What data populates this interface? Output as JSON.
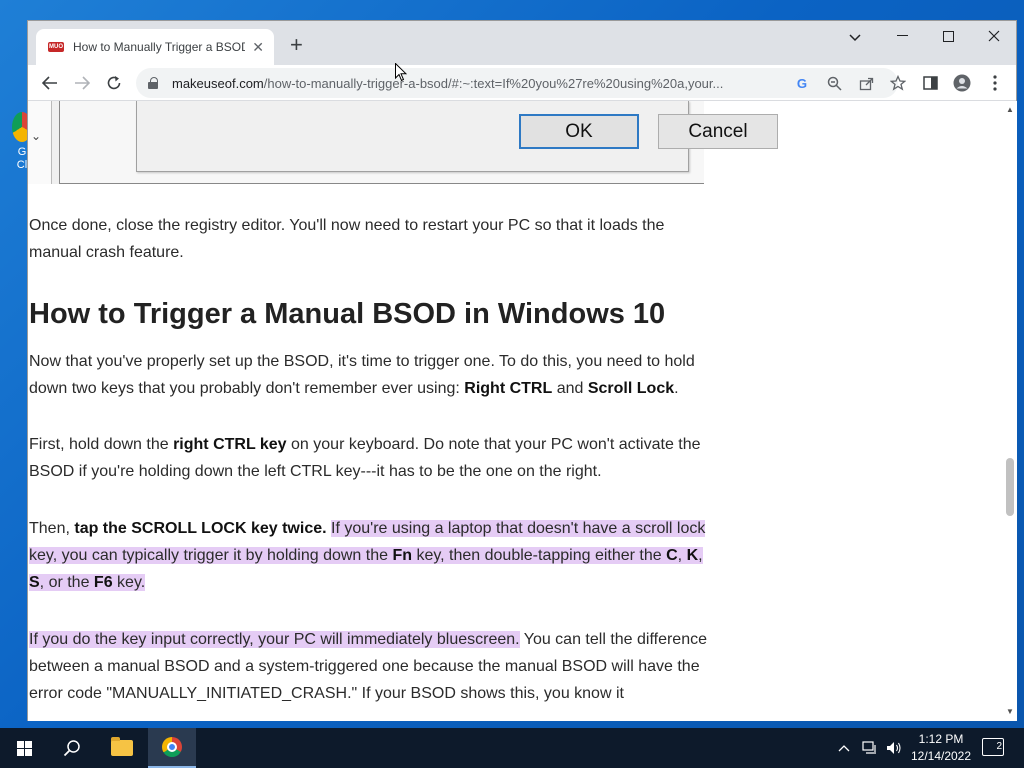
{
  "desktop": {
    "icon_label": "G\nCl"
  },
  "browser": {
    "tab_title": "How to Manually Trigger a BSOD",
    "tab_close": "✕",
    "new_tab": "+",
    "url_domain": "makeuseof.com",
    "url_path": "/how-to-manually-trigger-a-bsod/#:~:text=If%20you%27re%20using%20a,your...",
    "window_controls": {
      "tab_search": "⌄",
      "minimize": "—",
      "maximize": "☐",
      "close": "✕"
    }
  },
  "page": {
    "dialog": {
      "ok": "OK",
      "cancel": "Cancel"
    },
    "p1": "Once done, close the registry editor. You'll now need to restart your PC so that it loads the manual crash feature.",
    "heading": "How to Trigger a Manual BSOD in Windows 10",
    "p2_a": "Now that you've properly set up the BSOD, it's time to trigger one. To do this, you need to hold down two keys that you probably don't remember ever using: ",
    "p2_b1": "Right CTRL",
    "p2_and": " and ",
    "p2_b2": "Scroll Lock",
    "p2_end": ".",
    "p3_a": "First, hold down the ",
    "p3_b": "right CTRL key",
    "p3_c": " on your keyboard. Do note that your PC won't activate the BSOD if you're holding down the left CTRL key---it has to be the one on the right.",
    "p4_a": "Then, ",
    "p4_b": "tap the SCROLL LOCK key twice.",
    "p4_space": " ",
    "p4_h1": "If you're using a laptop that doesn't have a scroll lock key, you can typically trigger it by holding down the ",
    "p4_fn": "Fn",
    "p4_h2": " key, then double-tapping either the ",
    "p4_c": "C",
    "p4_comma1": ", ",
    "p4_k": "K",
    "p4_comma2": ", ",
    "p4_s": "S",
    "p4_or": ", or the ",
    "p4_f6": "F6",
    "p4_key": " key.",
    "p5_h": "If you do the key input correctly, your PC will immediately bluescreen.",
    "p5_rest": " You can tell the difference between a manual BSOD and a system-triggered one because the manual BSOD will have the error code \"MANUALLY_INITIATED_CRASH.\" If your BSOD shows this, you know it"
  },
  "taskbar": {
    "time": "1:12 PM",
    "date": "12/14/2022",
    "notification_count": "2"
  },
  "colors": {
    "highlight": "#e5ccf5",
    "taskbar": "#0d1a2b",
    "desktop": "#0b63c4"
  }
}
